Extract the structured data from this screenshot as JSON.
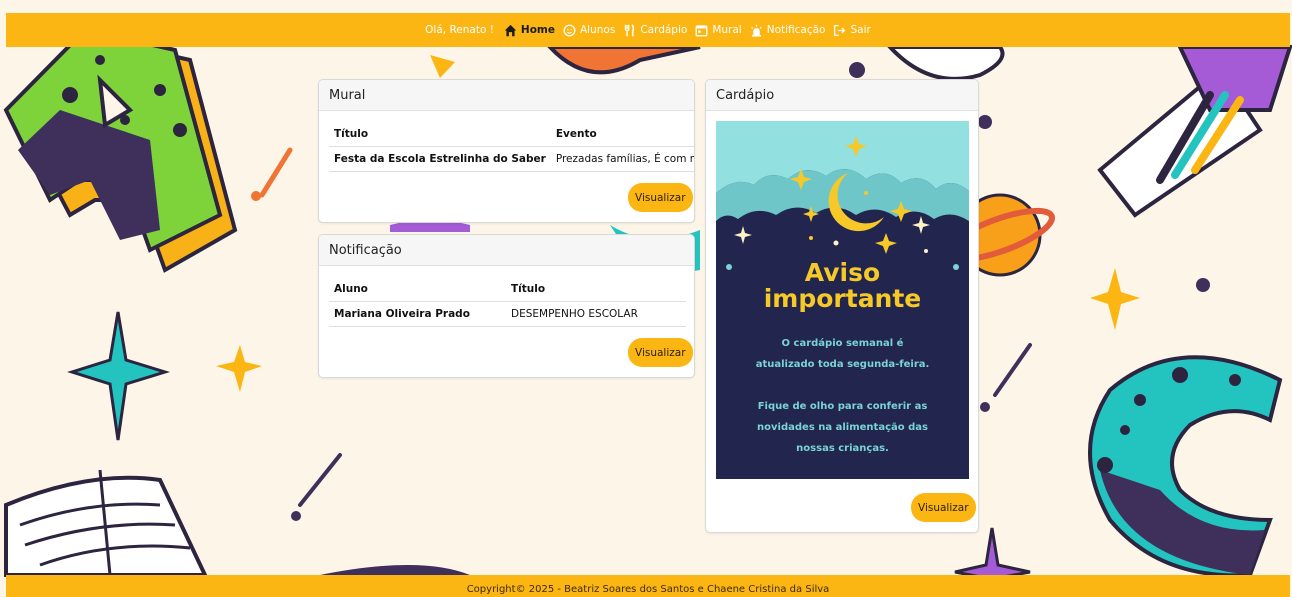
{
  "nav": {
    "greeting": "Olá, Renato !",
    "items": [
      {
        "label": "Home",
        "icon": "home-icon",
        "active": true
      },
      {
        "label": "Alunos",
        "icon": "child-face-icon",
        "active": false
      },
      {
        "label": "Cardápio",
        "icon": "fork-knife-icon",
        "active": false
      },
      {
        "label": "Mural",
        "icon": "calendar-icon",
        "active": false
      },
      {
        "label": "Notificação",
        "icon": "alarm-icon",
        "active": false
      },
      {
        "label": "Sair",
        "icon": "logout-icon",
        "active": false
      }
    ]
  },
  "mural": {
    "title": "Mural",
    "columns": [
      "Título",
      "Evento"
    ],
    "rows": [
      {
        "titulo": "Festa da Escola Estrelinha do Saber",
        "evento": "Prezadas famílias, É com muita alegr..."
      }
    ],
    "button": "Visualizar"
  },
  "notificacao": {
    "title": "Notificação",
    "columns": [
      "Aluno",
      "Título"
    ],
    "rows": [
      {
        "aluno": "Mariana Oliveira Prado",
        "titulo": "DESEMPENHO ESCOLAR"
      }
    ],
    "button": "Visualizar"
  },
  "cardapio": {
    "title": "Cardápio",
    "poster_title_1": "Aviso",
    "poster_title_2": "importante",
    "poster_text_1": "O cardápio semanal é",
    "poster_text_2": "atualizado toda segunda-feira.",
    "poster_text_3": "Fique de olho para conferir as",
    "poster_text_4": "novidades na alimentação das",
    "poster_text_5": "nossas crianças.",
    "button": "Visualizar"
  },
  "footer": {
    "text": "Copyright© 2025 - Beatriz Soares dos Santos e Chaene Cristina da Silva"
  },
  "colors": {
    "accent": "#fbb614",
    "background": "#fdf6e8",
    "poster_bg": "#22264e",
    "poster_text": "#7ad3d6",
    "moon": "#f6c928"
  }
}
